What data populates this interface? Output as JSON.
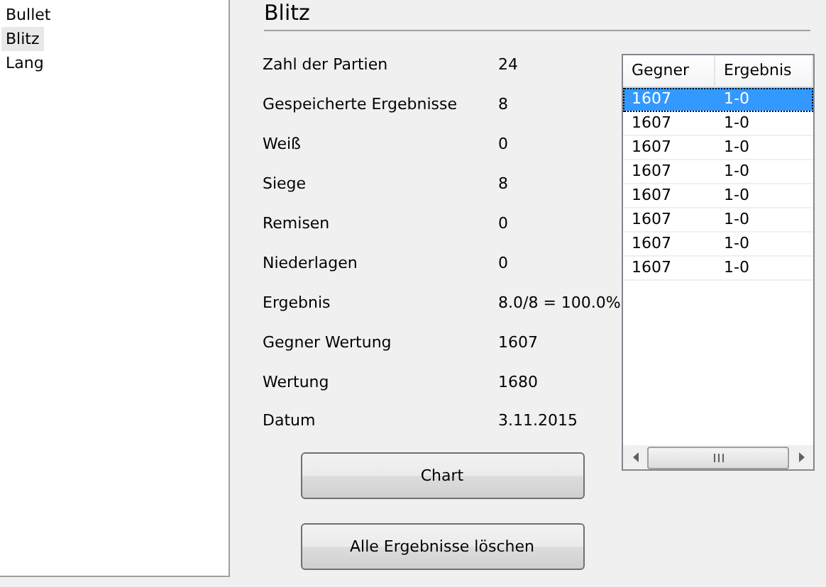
{
  "sidebar": {
    "items": [
      {
        "label": "Bullet",
        "selected": false
      },
      {
        "label": "Blitz",
        "selected": true
      },
      {
        "label": "Lang",
        "selected": false
      }
    ]
  },
  "panel": {
    "title": "Blitz",
    "stats": [
      {
        "label": "Zahl der Partien",
        "value": "24"
      },
      {
        "label": "Gespeicherte Ergebnisse",
        "value": "8"
      },
      {
        "label": "Weiß",
        "value": "0"
      },
      {
        "label": "Siege",
        "value": "8"
      },
      {
        "label": "Remisen",
        "value": "0"
      },
      {
        "label": "Niederlagen",
        "value": "0"
      },
      {
        "label": "Ergebnis",
        "value": "8.0/8 = 100.0%"
      },
      {
        "label": "Gegner Wertung",
        "value": "1607"
      },
      {
        "label": "Wertung",
        "value": "1680"
      },
      {
        "label": "Datum",
        "value": "3.11.2015"
      }
    ],
    "buttons": [
      "Chart",
      "Alle Ergebnisse löschen"
    ],
    "table": {
      "columns": [
        "Gegner",
        "Ergebnis"
      ],
      "rows": [
        {
          "cells": [
            "1607",
            "1-0"
          ],
          "selected": true
        },
        {
          "cells": [
            "1607",
            "1-0"
          ],
          "selected": false
        },
        {
          "cells": [
            "1607",
            "1-0"
          ],
          "selected": false
        },
        {
          "cells": [
            "1607",
            "1-0"
          ],
          "selected": false
        },
        {
          "cells": [
            "1607",
            "1-0"
          ],
          "selected": false
        },
        {
          "cells": [
            "1607",
            "1-0"
          ],
          "selected": false
        },
        {
          "cells": [
            "1607",
            "1-0"
          ],
          "selected": false
        },
        {
          "cells": [
            "1607",
            "1-0"
          ],
          "selected": false
        }
      ]
    }
  }
}
